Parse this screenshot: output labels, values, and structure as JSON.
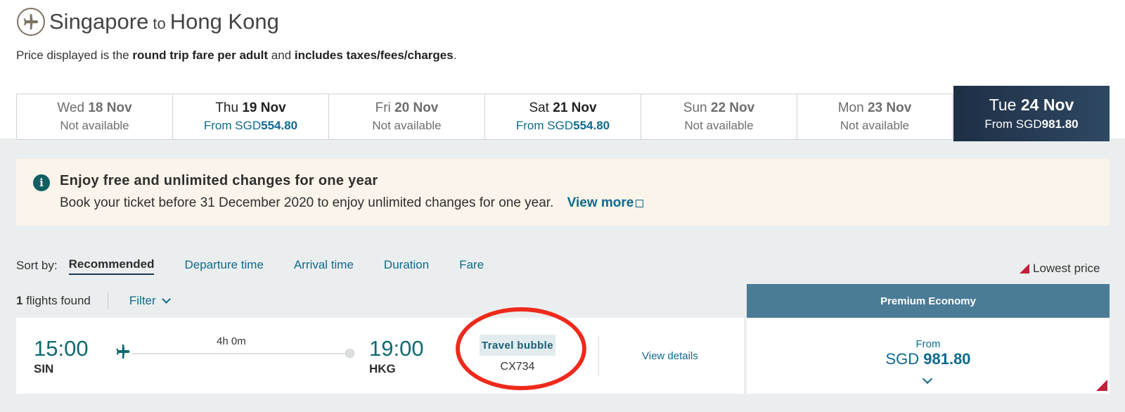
{
  "header": {
    "origin": "Singapore",
    "to_word": "to",
    "destination": "Hong Kong",
    "icon": "plane-icon"
  },
  "subline": {
    "prefix": "Price displayed is the ",
    "bold1": "round trip fare per adult",
    "middle": " and ",
    "bold2": "includes taxes/fees/charges",
    "suffix": "."
  },
  "dates": [
    {
      "weekday": "Wed",
      "date": "18 Nov",
      "status": "Not available"
    },
    {
      "weekday": "Thu",
      "date": "19 Nov",
      "from_label": "From SGD",
      "price": "554.80"
    },
    {
      "weekday": "Fri",
      "date": "20 Nov",
      "status": "Not available"
    },
    {
      "weekday": "Sat",
      "date": "21 Nov",
      "from_label": "From SGD",
      "price": "554.80"
    },
    {
      "weekday": "Sun",
      "date": "22 Nov",
      "status": "Not available"
    },
    {
      "weekday": "Mon",
      "date": "23 Nov",
      "status": "Not available"
    },
    {
      "weekday": "Tue",
      "date": "24 Nov",
      "from_label": "From SGD",
      "price": "981.80"
    }
  ],
  "banner": {
    "icon": "info-icon",
    "icon_glyph": "i",
    "title": "Enjoy free and unlimited changes for one year",
    "text": "Book your ticket before 31 December 2020 to enjoy unlimited changes for one year.",
    "link": "View more"
  },
  "sort": {
    "label": "Sort by:",
    "options": [
      "Recommended",
      "Departure time",
      "Arrival time",
      "Duration",
      "Fare"
    ]
  },
  "legend": {
    "lowest_price": "Lowest price"
  },
  "results": {
    "count": "1",
    "found_label": " flights found",
    "filter_label": "Filter"
  },
  "cabin": {
    "header": "Premium Economy"
  },
  "flight": {
    "dep_time": "15:00",
    "dep_code": "SIN",
    "duration": "4h 0m",
    "arr_time": "19:00",
    "arr_code": "HKG",
    "badge": "Travel bubble",
    "flight_number": "CX734",
    "details_link": "View details",
    "price_from": "From",
    "currency": "SGD",
    "price": "981.80"
  },
  "colors": {
    "accent": "#0e6a8e",
    "teal_time": "#0f6a70",
    "selected_date_bg": "#223954",
    "cabin_header_bg": "#4a7c96",
    "lowest_marker": "#c3203c",
    "annotation_circle": "#ee2a1c"
  }
}
